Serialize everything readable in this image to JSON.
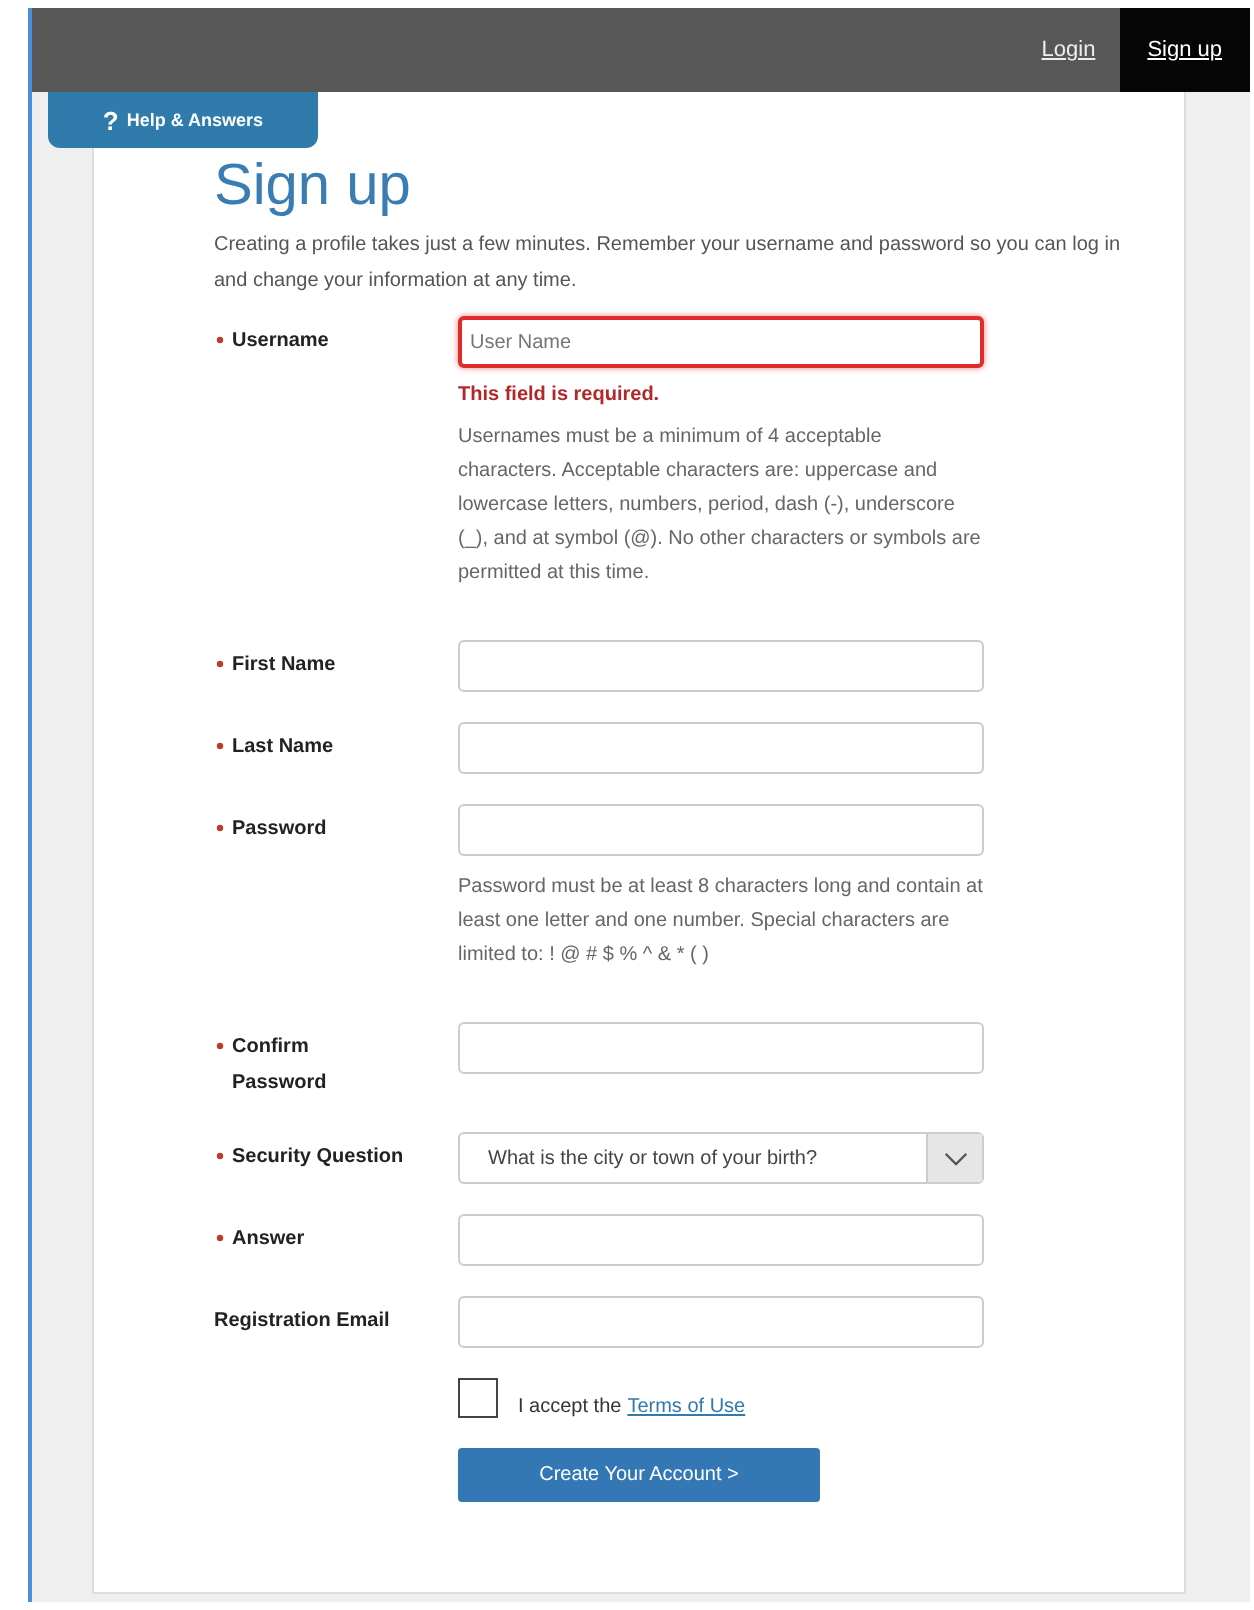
{
  "nav": [
    {
      "label": "Login",
      "selected": false
    },
    {
      "label": "Sign up",
      "selected": true
    }
  ],
  "help_tab": {
    "icon": "?",
    "label": "Help & Answers"
  },
  "title": "Sign up",
  "intro": "Creating a profile takes just a few minutes. Remember your username and password so you can log in and change your information at any time.",
  "fields": [
    {
      "kind": "text",
      "label": "Username",
      "required": true,
      "placeholder": "User Name",
      "invalid": true,
      "error": "This field is required.",
      "help": "Usernames must be a minimum of 4 acceptable characters. Acceptable characters are: uppercase and lowercase letters, numbers, period, dash (-), underscore (_), and at symbol (@). No other characters or symbols are permitted at this time."
    },
    {
      "kind": "text",
      "label": "First Name",
      "required": true,
      "invalid": false
    },
    {
      "kind": "text",
      "label": "Last Name",
      "required": true,
      "invalid": false
    },
    {
      "kind": "text",
      "label": "Password",
      "required": true,
      "invalid": false,
      "help": "Password must be at least 8 characters long and contain at least one letter and one number. Special characters are limited to: ! @ # $ % ^ & * ( )"
    },
    {
      "kind": "text",
      "label": "Confirm Password",
      "required": true,
      "invalid": false
    },
    {
      "kind": "select",
      "label": "Security Question",
      "required": true,
      "invalid": false,
      "value": "What is the city or town of your birth?"
    },
    {
      "kind": "text",
      "label": "Answer",
      "required": true,
      "invalid": false
    },
    {
      "kind": "text",
      "label": "Registration Email",
      "required": false,
      "invalid": false
    }
  ],
  "terms": {
    "checked": false,
    "text": "I accept the",
    "link": "Terms of Use"
  },
  "submit": "Create Your Account >"
}
